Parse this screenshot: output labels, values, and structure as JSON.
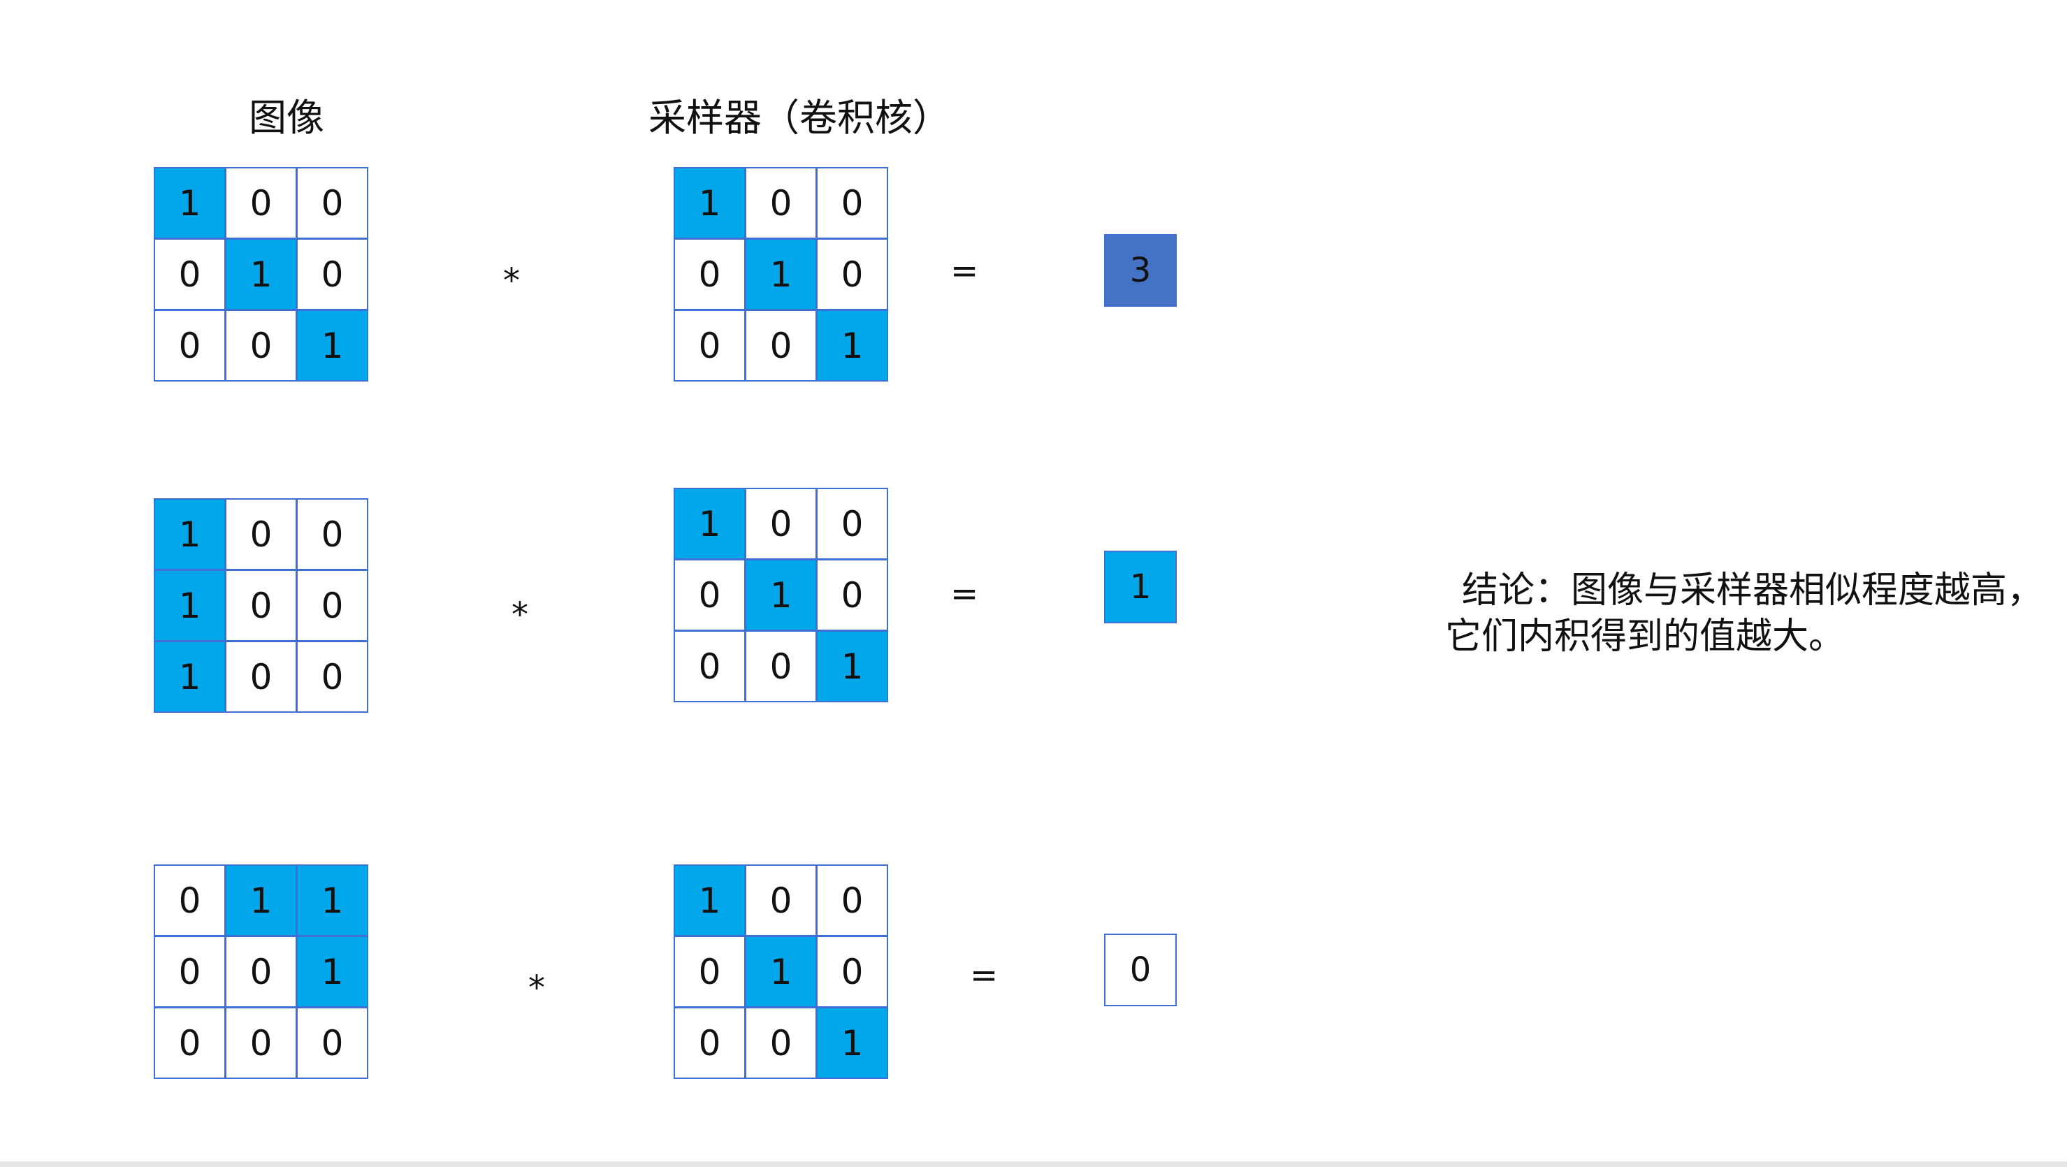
{
  "headers": {
    "image": "图像",
    "kernel": "采样器（卷积核）"
  },
  "colors": {
    "active_cell": "#00a7ea",
    "grid_border": "#3f6fd4",
    "result_strong": "#4472c4",
    "result_medium": "#00a7ea",
    "result_none": "#ffffff"
  },
  "rows": [
    {
      "image": [
        [
          1,
          0,
          0
        ],
        [
          0,
          1,
          0
        ],
        [
          0,
          0,
          1
        ]
      ],
      "kernel": [
        [
          1,
          0,
          0
        ],
        [
          0,
          1,
          0
        ],
        [
          0,
          0,
          1
        ]
      ],
      "operator": "*",
      "equals": "=",
      "result": "3"
    },
    {
      "image": [
        [
          1,
          0,
          0
        ],
        [
          1,
          0,
          0
        ],
        [
          1,
          0,
          0
        ]
      ],
      "kernel": [
        [
          1,
          0,
          0
        ],
        [
          0,
          1,
          0
        ],
        [
          0,
          0,
          1
        ]
      ],
      "operator": "*",
      "equals": "=",
      "result": "1"
    },
    {
      "image": [
        [
          0,
          1,
          1
        ],
        [
          0,
          0,
          1
        ],
        [
          0,
          0,
          0
        ]
      ],
      "kernel": [
        [
          1,
          0,
          0
        ],
        [
          0,
          1,
          0
        ],
        [
          0,
          0,
          1
        ]
      ],
      "operator": "*",
      "equals": "=",
      "result": "0"
    }
  ],
  "conclusion": {
    "line1": "结论：图像与采样器相似程度越高，",
    "line2": "它们内积得到的值越大。"
  }
}
